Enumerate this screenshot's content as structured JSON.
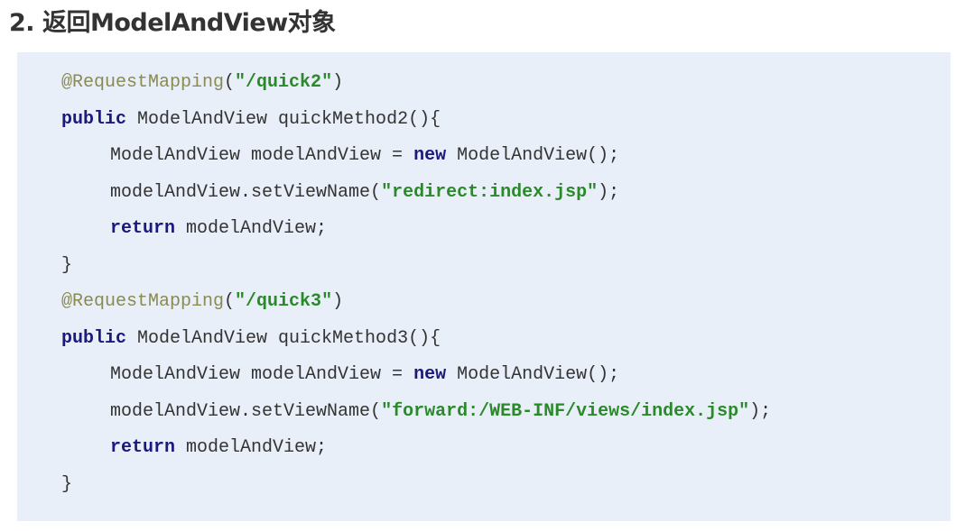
{
  "heading": {
    "number": "2.",
    "title": "返回ModelAndView对象"
  },
  "code": {
    "line1": {
      "annotation": "@RequestMapping",
      "open": "(",
      "string": "\"/quick2\"",
      "close": ")"
    },
    "line2": {
      "keyword": "public",
      "rest": " ModelAndView quickMethod2(){"
    },
    "line3": {
      "before": "ModelAndView modelAndView = ",
      "keyword": "new",
      "after": " ModelAndView();"
    },
    "line4": {
      "before": "modelAndView.setViewName(",
      "string": "\"redirect:index.jsp\"",
      "after": ");"
    },
    "line5": {
      "keyword": "return",
      "after": " modelAndView;"
    },
    "line6": {
      "text": "}"
    },
    "line7": {
      "annotation": "@RequestMapping",
      "open": "(",
      "string": "\"/quick3\"",
      "close": ")"
    },
    "line8": {
      "keyword": "public",
      "rest": " ModelAndView quickMethod3(){"
    },
    "line9": {
      "before": "ModelAndView modelAndView = ",
      "keyword": "new",
      "after": " ModelAndView();"
    },
    "line10": {
      "before": "modelAndView.setViewName(",
      "string": "\"forward:/WEB-INF/views/index.jsp\"",
      "after": ");"
    },
    "line11": {
      "keyword": "return",
      "after": " modelAndView;"
    },
    "line12": {
      "text": "}"
    }
  }
}
